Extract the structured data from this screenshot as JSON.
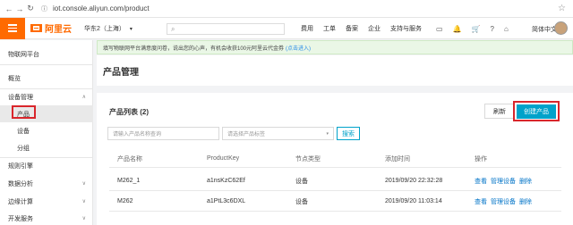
{
  "browser": {
    "url": "iot.console.aliyun.com/product",
    "back_icon": "←",
    "forward_icon": "→",
    "reload_icon": "↻"
  },
  "topnav": {
    "logo_text": "阿里云",
    "region": "华东2（上海）",
    "region_caret": "▾",
    "search_icon": "⌕",
    "links": [
      "费用",
      "工单",
      "备案",
      "企业",
      "支持与服务"
    ],
    "icons": [
      "▭",
      "🔔",
      "🛒",
      "?",
      "⌂"
    ],
    "language": "简体中文"
  },
  "sidebar": {
    "platform": "物联网平台",
    "items": [
      {
        "label": "概览"
      },
      {
        "label": "设备管理",
        "chevron": "∧"
      },
      {
        "label": "产品"
      },
      {
        "label": "设备"
      },
      {
        "label": "分组"
      },
      {
        "label": "规则引擎",
        "chevron": "∨"
      },
      {
        "label": "数据分析",
        "chevron": "∨"
      },
      {
        "label": "边缘计算",
        "chevron": "∨"
      },
      {
        "label": "开发服务",
        "chevron": "∨"
      }
    ]
  },
  "notice": {
    "text": "填写物联网平台满意度问卷，说出您的心声，有机会收获100元阿里云代金券",
    "link": "(点击进入)"
  },
  "page": {
    "title": "产品管理"
  },
  "card": {
    "title": "产品列表 (2)",
    "refresh_label": "刷新",
    "create_label": "创建产品",
    "search_placeholder": "请输入产品名称查询",
    "tag_placeholder": "请选择产品标签",
    "tag_caret": "▾",
    "search_label": "搜索"
  },
  "table": {
    "headers": [
      "产品名称",
      "ProductKey",
      "节点类型",
      "添加时间",
      "操作"
    ],
    "rows": [
      {
        "name": "M262_1",
        "key": "a1nsKzC62Ef",
        "node": "设备",
        "time": "2019/09/20 22:32:28",
        "actions": [
          "查看",
          "管理设备",
          "删除"
        ]
      },
      {
        "name": "M262",
        "key": "a1PtL3c6DXL",
        "node": "设备",
        "time": "2019/09/20 11:03:14",
        "actions": [
          "查看",
          "管理设备",
          "删除"
        ]
      }
    ]
  },
  "colors": {
    "brand": "#ff6a00",
    "primary": "#00a2ca",
    "highlight_border": "#d9262c",
    "link": "#0073c7"
  }
}
